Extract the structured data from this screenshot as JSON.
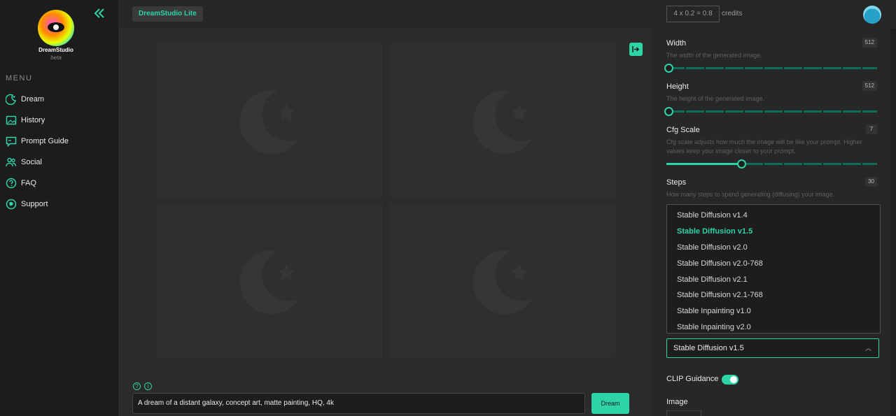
{
  "sidebar": {
    "brand_name": "DreamStudio",
    "brand_sub": "beta",
    "menu_title": "MENU",
    "items": [
      {
        "label": "Dream",
        "icon": "dream-icon"
      },
      {
        "label": "History",
        "icon": "history-icon"
      },
      {
        "label": "Prompt Guide",
        "icon": "prompt-guide-icon"
      },
      {
        "label": "Social",
        "icon": "social-icon"
      },
      {
        "label": "FAQ",
        "icon": "faq-icon"
      },
      {
        "label": "Support",
        "icon": "support-icon"
      }
    ]
  },
  "topbar": {
    "badge": "DreamStudio Lite",
    "credits_formula": "4 x 0.2 = 0.8",
    "credits_label": "credits"
  },
  "main": {
    "prompt_value": "A dream of a distant galaxy, concept art, matte painting, HQ, 4k",
    "dream_button": "Dream"
  },
  "settings": {
    "width": {
      "label": "Width",
      "value": "512",
      "desc": "The width of the generated image.",
      "level": 0.0
    },
    "height": {
      "label": "Height",
      "value": "512",
      "desc": "The height of the generated image.",
      "level": 0.0
    },
    "cfg": {
      "label": "Cfg Scale",
      "value": "7",
      "desc": "Cfg scale adjusts how much the image will be like your prompt. Higher values keep your image closer to your prompt.",
      "level": 0.35
    },
    "steps": {
      "label": "Steps",
      "value": "30",
      "desc": "How many steps to spend generating (diffusing) your image."
    }
  },
  "model": {
    "options": [
      "Stable Diffusion v1.4",
      "Stable Diffusion v1.5",
      "Stable Diffusion v2.0",
      "Stable Diffusion v2.0-768",
      "Stable Diffusion v2.1",
      "Stable Diffusion v2.1-768",
      "Stable Inpainting v1.0",
      "Stable Inpainting v2.0"
    ],
    "selected": "Stable Diffusion v1.5"
  },
  "clip": {
    "label": "CLIP Guidance",
    "on": true
  },
  "image": {
    "label": "Image"
  },
  "colors": {
    "accent": "#2ed3a6",
    "background": "#2b2b2b",
    "sidebar": "#1c1c1c"
  }
}
